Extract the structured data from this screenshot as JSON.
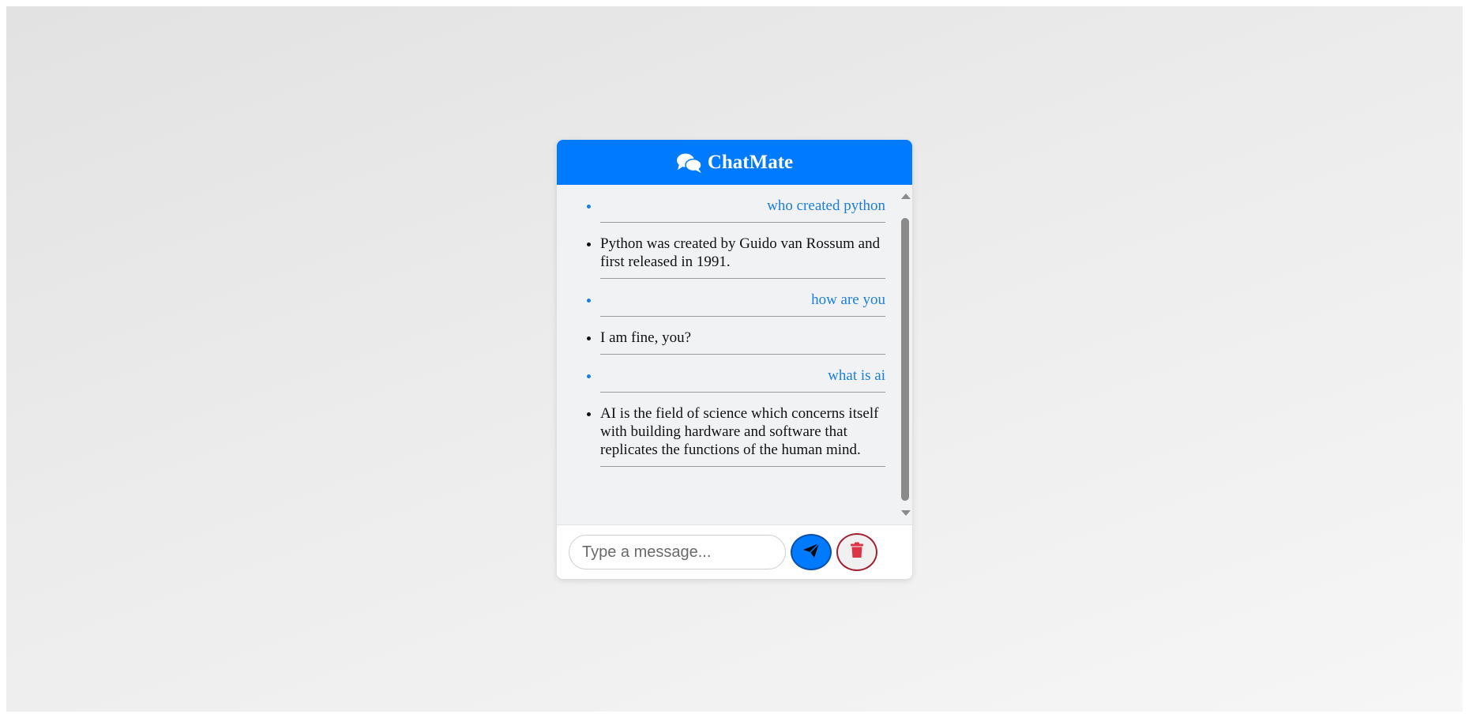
{
  "app": {
    "title": "ChatMate",
    "header_icon": "comments-icon",
    "accent_color": "#007bff"
  },
  "messages": [
    {
      "sender": "user",
      "text": "who created python"
    },
    {
      "sender": "bot",
      "text": "Python was created by Guido van Rossum and first released in 1991."
    },
    {
      "sender": "user",
      "text": "how are you"
    },
    {
      "sender": "bot",
      "text": "I am fine, you?"
    },
    {
      "sender": "user",
      "text": "what is ai"
    },
    {
      "sender": "bot",
      "text": "AI is the field of science which concerns itself with building hardware and software that replicates the functions of the human mind."
    }
  ],
  "input": {
    "placeholder": "Type a message...",
    "value": ""
  },
  "buttons": {
    "send_icon": "paper-plane-icon",
    "clear_icon": "trash-icon"
  }
}
